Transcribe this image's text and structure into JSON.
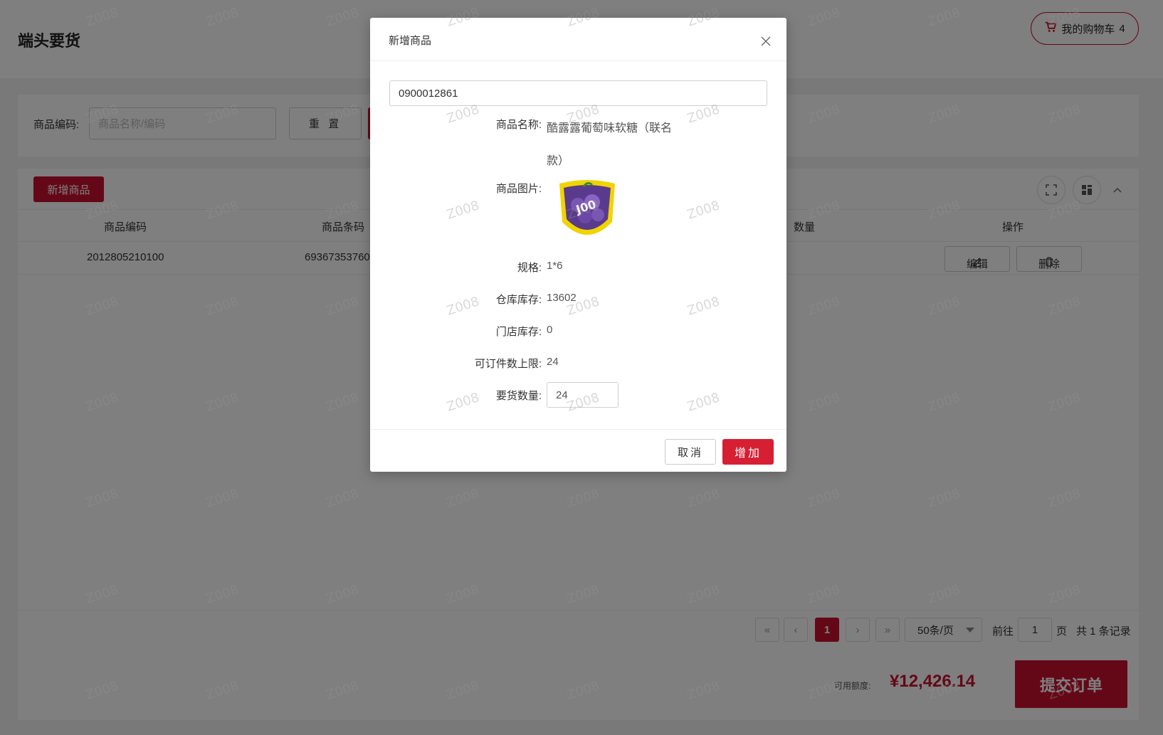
{
  "page": {
    "title": "端头要货"
  },
  "cart": {
    "label": "我的购物车",
    "count": "4",
    "icon": "shopping-cart-icon"
  },
  "search": {
    "label": "商品编码:",
    "placeholder": "商品名称/编码",
    "reset_label": "重 置"
  },
  "toolbar": {
    "add_label": "新增商品"
  },
  "table": {
    "columns": [
      "商品编码",
      "商品条码",
      "数量",
      "操作"
    ],
    "rows": [
      {
        "code": "2012805210100",
        "barcode": "69367353760",
        "edit_label": "编辑",
        "delete_label": "删除"
      }
    ]
  },
  "pagination": {
    "current": "1",
    "page_size": "50条/页",
    "goto_label": "前往",
    "goto_value": "1",
    "page_unit": "页",
    "total_text": "共 1 条记录"
  },
  "footer": {
    "credit_label": "可用额度:",
    "credit_value": "¥12,426.14",
    "submit_label": "提交订单"
  },
  "modal": {
    "title": "新增商品",
    "code_value": "0900012861",
    "name_label": "商品名称:",
    "name_value": "酷露露葡萄味软糖（联名款）",
    "image_label": "商品图片:",
    "spec_label": "规格:",
    "spec_value": "1*6",
    "warehouse_stock_label": "仓库库存:",
    "warehouse_stock_value": "13602",
    "store_stock_label": "门店库存:",
    "store_stock_value": "0",
    "order_limit_label": "可订件数上限:",
    "order_limit_value": "24",
    "qty_label": "要货数量:",
    "qty_value": "24",
    "cancel_label": "取消",
    "confirm_label": "增加"
  },
  "watermark": {
    "text": "Z008"
  },
  "colors": {
    "brand": "#c8102e",
    "confirm": "#d71f33"
  }
}
